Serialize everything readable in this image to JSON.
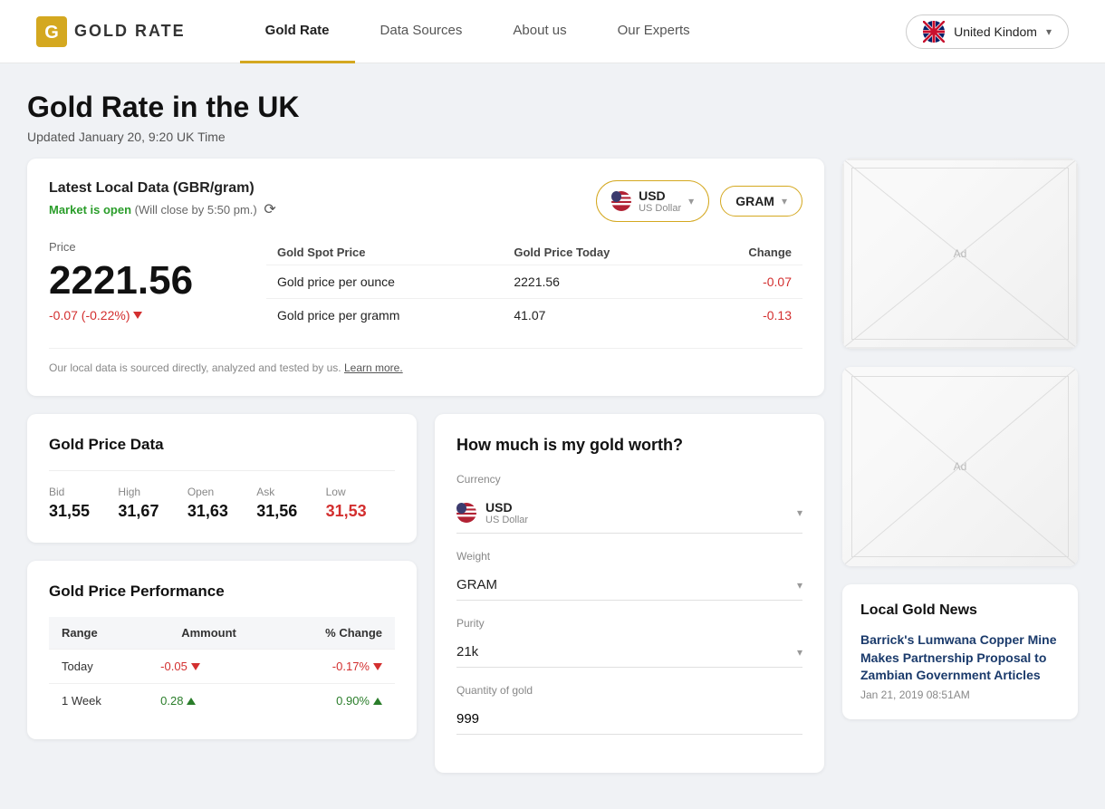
{
  "nav": {
    "logo_text": "GOLD RATE",
    "links": [
      {
        "label": "Gold Rate",
        "active": true
      },
      {
        "label": "Data Sources",
        "active": false
      },
      {
        "label": "About us",
        "active": false
      },
      {
        "label": "Our Experts",
        "active": false
      }
    ],
    "country": "United Kindom",
    "country_flag": "uk"
  },
  "page": {
    "title": "Gold Rate in the UK",
    "updated": "Updated January 20, 9:20 UK Time"
  },
  "latest": {
    "title": "Latest Local Data (GBR/gram)",
    "market_open": "Market is open",
    "market_note": "(Will close by 5:50 pm.)",
    "currency_code": "USD",
    "currency_name": "US Dollar",
    "unit": "GRAM",
    "price_label": "Price",
    "price": "2221.56",
    "change": "-0.07 (-0.22%)",
    "table_headers": [
      "Gold Spot Price",
      "Gold Price Today",
      "Change"
    ],
    "rows": [
      {
        "label": "Gold price per ounce",
        "today": "2221.56",
        "change": "-0.07"
      },
      {
        "label": "Gold price per gramm",
        "today": "41.07",
        "change": "-0.13"
      }
    ],
    "footnote": "Our local data is sourced directly, analyzed and tested by us.",
    "learn_more": "Learn more."
  },
  "gold_data": {
    "title": "Gold Price Data",
    "items": [
      {
        "label": "Bid",
        "value": "31,55"
      },
      {
        "label": "High",
        "value": "31,67"
      },
      {
        "label": "Open",
        "value": "31,63"
      },
      {
        "label": "Ask",
        "value": "31,56"
      },
      {
        "label": "Low",
        "value": "31,53"
      }
    ]
  },
  "performance": {
    "title": "Gold Price Performance",
    "headers": [
      "Range",
      "Ammount",
      "% Change"
    ],
    "rows": [
      {
        "range": "Today",
        "amount": "-0.05",
        "amount_dir": "neg",
        "pct": "-0.17%",
        "pct_dir": "neg"
      },
      {
        "range": "1 Week",
        "amount": "0.28",
        "amount_dir": "pos",
        "pct": "0.90%",
        "pct_dir": "pos"
      }
    ]
  },
  "worth_calc": {
    "title": "How much is my gold worth?",
    "currency_label": "Currency",
    "currency_code": "USD",
    "currency_name": "US Dollar",
    "weight_label": "Weight",
    "weight_value": "GRAM",
    "purity_label": "Purity",
    "purity_value": "21k",
    "quantity_label": "Quantity of gold",
    "quantity_value": "999"
  },
  "news": {
    "title": "Local Gold News",
    "items": [
      {
        "title": "Barrick's Lumwana Copper Mine Makes Partnership Proposal to Zambian Government Articles",
        "date": "Jan 21, 2019 08:51AM"
      }
    ]
  },
  "ads": [
    {
      "label": "Ad"
    },
    {
      "label": "Ad"
    }
  ]
}
